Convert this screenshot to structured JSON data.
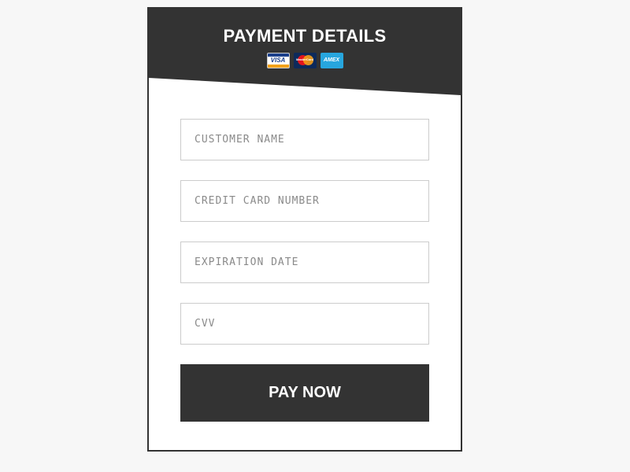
{
  "header": {
    "title": "PAYMENT DETAILS",
    "card_logos": [
      {
        "name": "visa",
        "label": "VISA"
      },
      {
        "name": "mastercard",
        "label": "MasterCard"
      },
      {
        "name": "amex",
        "label": "AMEX"
      }
    ]
  },
  "form": {
    "fields": [
      {
        "name": "customer-name",
        "value": "",
        "placeholder": "CUSTOMER NAME"
      },
      {
        "name": "credit-card-number",
        "value": "",
        "placeholder": "CREDIT CARD NUMBER"
      },
      {
        "name": "expiration-date",
        "value": "",
        "placeholder": "EXPIRATION DATE"
      },
      {
        "name": "cvv",
        "value": "",
        "placeholder": "CVV"
      }
    ],
    "submit_label": "PAY NOW"
  },
  "colors": {
    "header_background": "#333333",
    "page_background": "#f7f7f7",
    "card_background": "#ffffff",
    "button_background": "#333333",
    "button_text": "#ffffff"
  }
}
